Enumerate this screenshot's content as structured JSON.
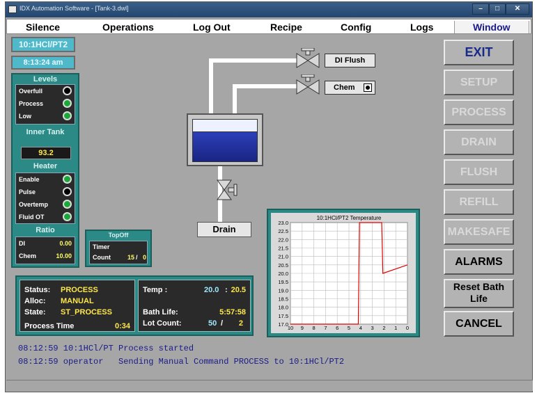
{
  "titlebar": {
    "title": "IDX Automation Software - [Tank-3.dwl]"
  },
  "menu": [
    "Silence",
    "Operations",
    "Log Out",
    "Recipe",
    "Config",
    "Logs",
    "Window"
  ],
  "header": {
    "station": "10:1HCl/PT2",
    "time": "8:13:24 am"
  },
  "levels": {
    "title": "Levels",
    "items": [
      {
        "label": "Overfull",
        "state": "off"
      },
      {
        "label": "Process",
        "state": "on"
      },
      {
        "label": "Low",
        "state": "on"
      }
    ]
  },
  "inner_tank": {
    "title": "Inner Tank",
    "value": "93.2"
  },
  "heater": {
    "title": "Heater",
    "items": [
      {
        "label": "Enable",
        "state": "on"
      },
      {
        "label": "Pulse",
        "state": "off"
      },
      {
        "label": "Overtemp",
        "state": "on"
      },
      {
        "label": "Fluid OT",
        "state": "on"
      }
    ]
  },
  "ratio": {
    "title": "Ratio",
    "items": [
      {
        "label": "DI",
        "value": "0.00"
      },
      {
        "label": "Chem",
        "value": "10.00"
      }
    ]
  },
  "topoff": {
    "title": "TopOff",
    "timer_label": "Timer",
    "count_label": "Count",
    "count_value": "15",
    "count_sep": "/",
    "count_max": "0"
  },
  "diagram": {
    "di_flush_label": "DI Flush",
    "chem_label": "Chem",
    "drain_label": "Drain",
    "tank_fill_fraction": 0.72
  },
  "buttons": [
    {
      "label": "EXIT",
      "style": "active"
    },
    {
      "label": "SETUP",
      "style": "disabled"
    },
    {
      "label": "PROCESS",
      "style": "disabled"
    },
    {
      "label": "DRAIN",
      "style": "disabled"
    },
    {
      "label": "FLUSH",
      "style": "disabled"
    },
    {
      "label": "REFILL",
      "style": "disabled"
    },
    {
      "label": "MAKESAFE",
      "style": "disabled"
    },
    {
      "label": "ALARMS",
      "style": "black"
    },
    {
      "label": "Reset Bath Life",
      "style": "two-line"
    },
    {
      "label": "CANCEL",
      "style": "black"
    }
  ],
  "status": {
    "status_label": "Status:",
    "status_value": "PROCESS",
    "alloc_label": "Alloc:",
    "alloc_value": "MANUAL",
    "state_label": "State:",
    "state_value": "ST_PROCESS",
    "ptime_label": "Process Time",
    "ptime_value": "0:34",
    "temp_label": "Temp :",
    "temp_value": "20.0",
    "temp_sep": ":",
    "temp_set": "20.5",
    "bath_label": "Bath Life:",
    "bath_value": "5:57:58",
    "lot_label": "Lot Count:",
    "lot_value": "50",
    "lot_sep": "/",
    "lot_max": "2"
  },
  "chart_data": {
    "type": "line",
    "title": "10:1HCl/PT2 Temperature",
    "xlabel": "",
    "ylabel": "",
    "x_ticks": [
      "10",
      "9",
      "8",
      "7",
      "6",
      "5",
      "4",
      "3",
      "2",
      "1",
      "0"
    ],
    "y_ticks": [
      "23.0",
      "22.5",
      "22.0",
      "21.5",
      "21.0",
      "20.5",
      "20.0",
      "19.5",
      "19.0",
      "18.5",
      "18.0",
      "17.5",
      "17.0"
    ],
    "xlim": [
      10,
      0
    ],
    "ylim": [
      17.0,
      23.0
    ],
    "grid": true,
    "series": [
      {
        "color": "#e00000",
        "x": [
          10,
          9,
          8,
          7,
          6,
          5,
          4.2,
          4.1,
          2.2,
          2.1,
          0
        ],
        "y": [
          17.0,
          17.0,
          17.0,
          17.0,
          17.0,
          17.0,
          17.0,
          23.0,
          23.0,
          20.0,
          20.5
        ]
      }
    ]
  },
  "log": [
    "08:12:59 10:1HCl/PT Process started",
    "08:12:59 operator   Sending Manual Command PROCESS to 10:1HCl/PT2"
  ]
}
